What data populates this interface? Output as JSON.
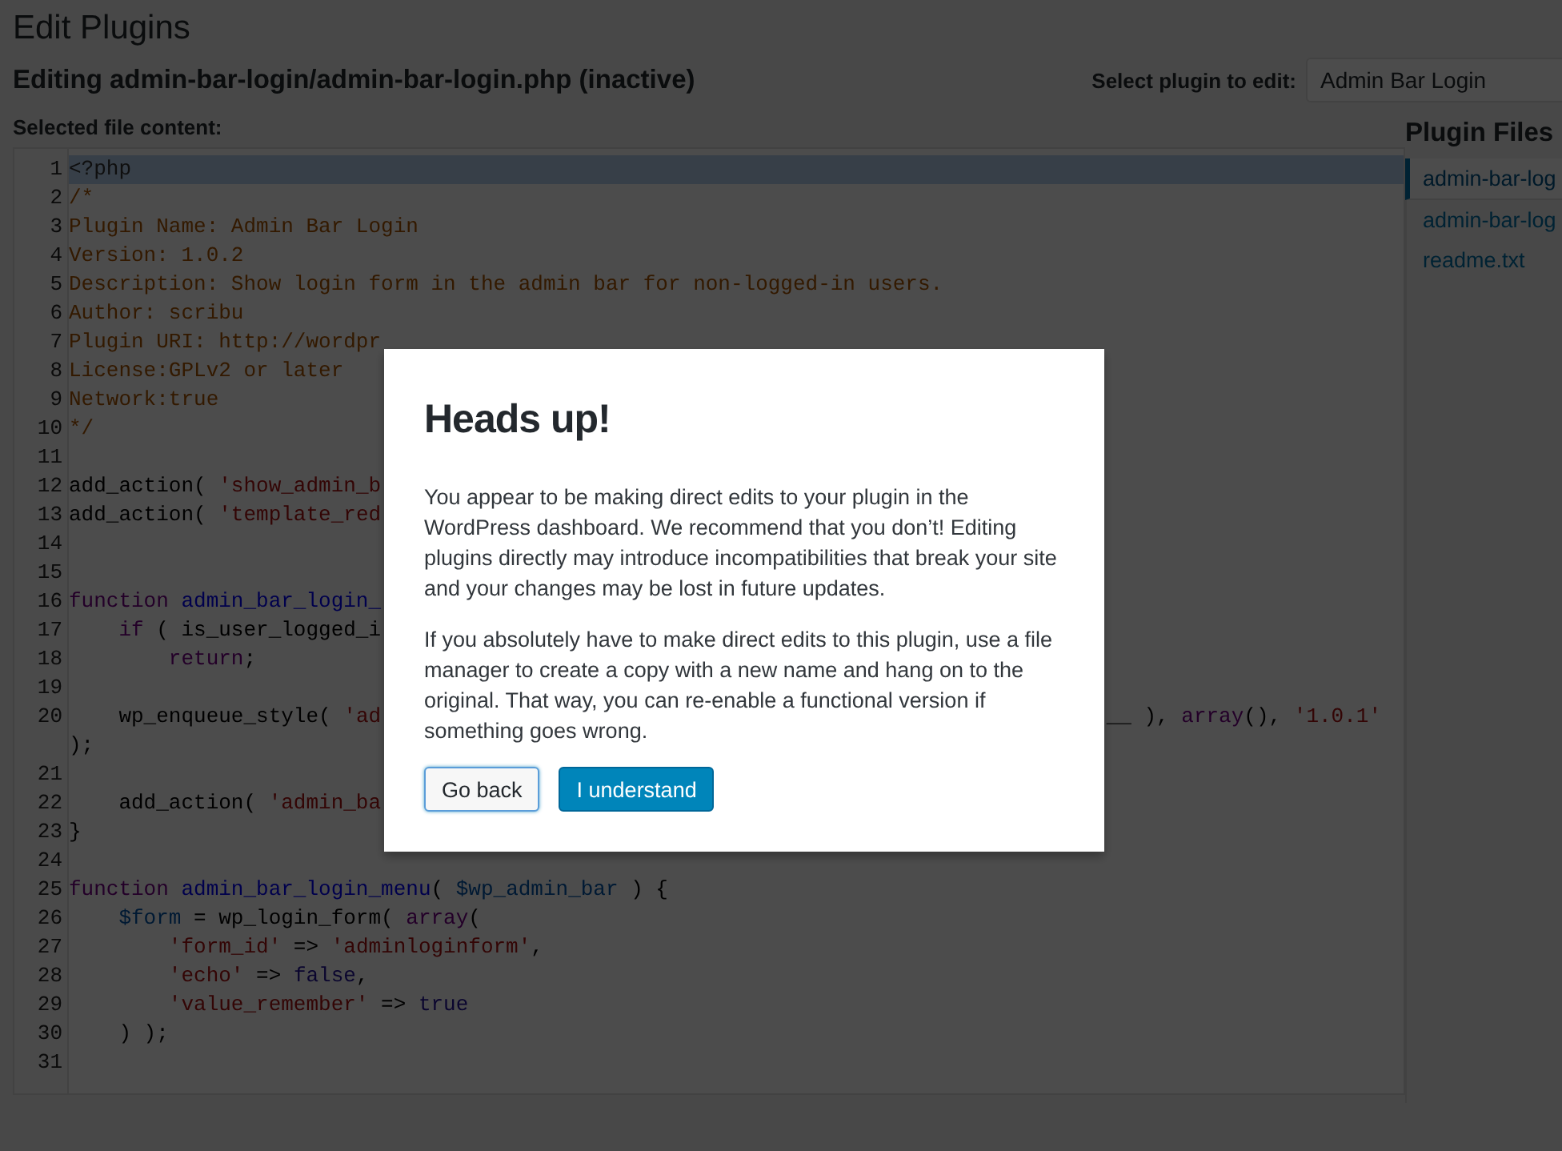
{
  "page_title": "Edit Plugins",
  "editing_heading": "Editing admin-bar-login/admin-bar-login.php (inactive)",
  "plugin_select": {
    "label": "Select plugin to edit:",
    "value": "Admin Bar Login"
  },
  "content_label": "Selected file content:",
  "code_lines": [
    {
      "number": "1",
      "selected": true,
      "segments": [
        {
          "kind": "meta",
          "text": "<?php"
        }
      ]
    },
    {
      "number": "2",
      "selected": false,
      "segments": [
        {
          "kind": "comment",
          "text": "/*"
        }
      ]
    },
    {
      "number": "3",
      "selected": false,
      "segments": [
        {
          "kind": "comment",
          "text": "Plugin Name: Admin Bar Login"
        }
      ]
    },
    {
      "number": "4",
      "selected": false,
      "segments": [
        {
          "kind": "comment",
          "text": "Version: 1.0.2"
        }
      ]
    },
    {
      "number": "5",
      "selected": false,
      "segments": [
        {
          "kind": "comment",
          "text": "Description: Show login form in the admin bar for non-logged-in users."
        }
      ]
    },
    {
      "number": "6",
      "selected": false,
      "segments": [
        {
          "kind": "comment",
          "text": "Author: scribu"
        }
      ]
    },
    {
      "number": "7",
      "selected": false,
      "segments": [
        {
          "kind": "comment",
          "text": "Plugin URI: http://wordpr"
        }
      ]
    },
    {
      "number": "8",
      "selected": false,
      "segments": [
        {
          "kind": "comment",
          "text": "License:GPLv2 or later"
        }
      ]
    },
    {
      "number": "9",
      "selected": false,
      "segments": [
        {
          "kind": "comment",
          "text": "Network:true"
        }
      ]
    },
    {
      "number": "10",
      "selected": false,
      "segments": [
        {
          "kind": "comment",
          "text": "*/"
        }
      ]
    },
    {
      "number": "11",
      "selected": false
    },
    {
      "number": "12",
      "selected": false,
      "segments": [
        {
          "kind": "plain",
          "text": "add_action( "
        },
        {
          "kind": "string",
          "text": "'show_admin_b"
        }
      ]
    },
    {
      "number": "13",
      "selected": false,
      "segments": [
        {
          "kind": "plain",
          "text": "add_action( "
        },
        {
          "kind": "string",
          "text": "'template_red"
        }
      ]
    },
    {
      "number": "14",
      "selected": false
    },
    {
      "number": "15",
      "selected": false
    },
    {
      "number": "16",
      "selected": false,
      "segments": [
        {
          "kind": "keyword",
          "text": "function "
        },
        {
          "kind": "def",
          "text": "admin_bar_login_"
        }
      ]
    },
    {
      "number": "17",
      "selected": false,
      "segments": [
        {
          "kind": "keyword",
          "text": "    if"
        },
        {
          "kind": "plain",
          "text": " ( is_user_logged_i"
        }
      ]
    },
    {
      "number": "18",
      "selected": false,
      "segments": [
        {
          "kind": "keyword",
          "text": "        return"
        },
        {
          "kind": "plain",
          "text": ";"
        }
      ]
    },
    {
      "number": "19",
      "selected": false
    },
    {
      "number": "20",
      "selected": false,
      "segments": [
        {
          "kind": "plain",
          "text": "    wp_enqueue_style( "
        },
        {
          "kind": "string",
          "text": "'ad"
        }
      ],
      "tail": [
        {
          "kind": "plain",
          "text": "__ ), "
        },
        {
          "kind": "keyword",
          "text": "array"
        },
        {
          "kind": "plain",
          "text": "(), "
        },
        {
          "kind": "string",
          "text": "'1.0.1'"
        }
      ]
    },
    {
      "selected": false,
      "segments": [
        {
          "kind": "plain",
          "text": ");"
        }
      ]
    },
    {
      "number": "21",
      "selected": false
    },
    {
      "number": "22",
      "selected": false,
      "segments": [
        {
          "kind": "plain",
          "text": "    add_action( "
        },
        {
          "kind": "string",
          "text": "'admin_ba"
        }
      ]
    },
    {
      "number": "23",
      "selected": false,
      "segments": [
        {
          "kind": "plain",
          "text": "}"
        }
      ]
    },
    {
      "number": "24",
      "selected": false
    },
    {
      "number": "25",
      "selected": false,
      "segments": [
        {
          "kind": "keyword",
          "text": "function "
        },
        {
          "kind": "def",
          "text": "admin_bar_login_menu"
        },
        {
          "kind": "plain",
          "text": "( "
        },
        {
          "kind": "variable",
          "text": "$wp_admin_bar"
        },
        {
          "kind": "plain",
          "text": " ) {"
        }
      ]
    },
    {
      "number": "26",
      "selected": false,
      "segments": [
        {
          "kind": "variable",
          "text": "    $form"
        },
        {
          "kind": "plain",
          "text": " = wp_login_form( "
        },
        {
          "kind": "keyword",
          "text": "array"
        },
        {
          "kind": "plain",
          "text": "("
        }
      ]
    },
    {
      "number": "27",
      "selected": false,
      "segments": [
        {
          "kind": "string",
          "text": "        'form_id'"
        },
        {
          "kind": "plain",
          "text": " => "
        },
        {
          "kind": "string",
          "text": "'adminloginform'"
        },
        {
          "kind": "plain",
          "text": ","
        }
      ]
    },
    {
      "number": "28",
      "selected": false,
      "segments": [
        {
          "kind": "string",
          "text": "        'echo'"
        },
        {
          "kind": "plain",
          "text": " => "
        },
        {
          "kind": "atom",
          "text": "false"
        },
        {
          "kind": "plain",
          "text": ","
        }
      ]
    },
    {
      "number": "29",
      "selected": false,
      "segments": [
        {
          "kind": "string",
          "text": "        'value_remember'"
        },
        {
          "kind": "plain",
          "text": " => "
        },
        {
          "kind": "atom",
          "text": "true"
        }
      ]
    },
    {
      "number": "30",
      "selected": false,
      "segments": [
        {
          "kind": "plain",
          "text": "    ) );"
        }
      ]
    },
    {
      "number": "31",
      "selected": false
    }
  ],
  "plugin_files": {
    "title": "Plugin Files",
    "items": [
      {
        "label": "admin-bar-log",
        "selected": true
      },
      {
        "label": "admin-bar-log",
        "selected": false
      },
      {
        "label": "readme.txt",
        "selected": false
      }
    ]
  },
  "dialog": {
    "title": "Heads up!",
    "paragraphs": [
      "You appear to be making direct edits to your plugin in the WordPress dashboard. We recommend that you don’t! Editing plugins directly may introduce incompatibilities that break your site and your changes may be lost in future updates.",
      "If you absolutely have to make direct edits to this plugin, use a file manager to create a copy with a new name and hang on to the original. That way, you can re-enable a functional version if something goes wrong."
    ],
    "buttons": [
      {
        "label": "Go back",
        "kind": "secondary"
      },
      {
        "label": "I understand",
        "kind": "primary"
      }
    ]
  }
}
